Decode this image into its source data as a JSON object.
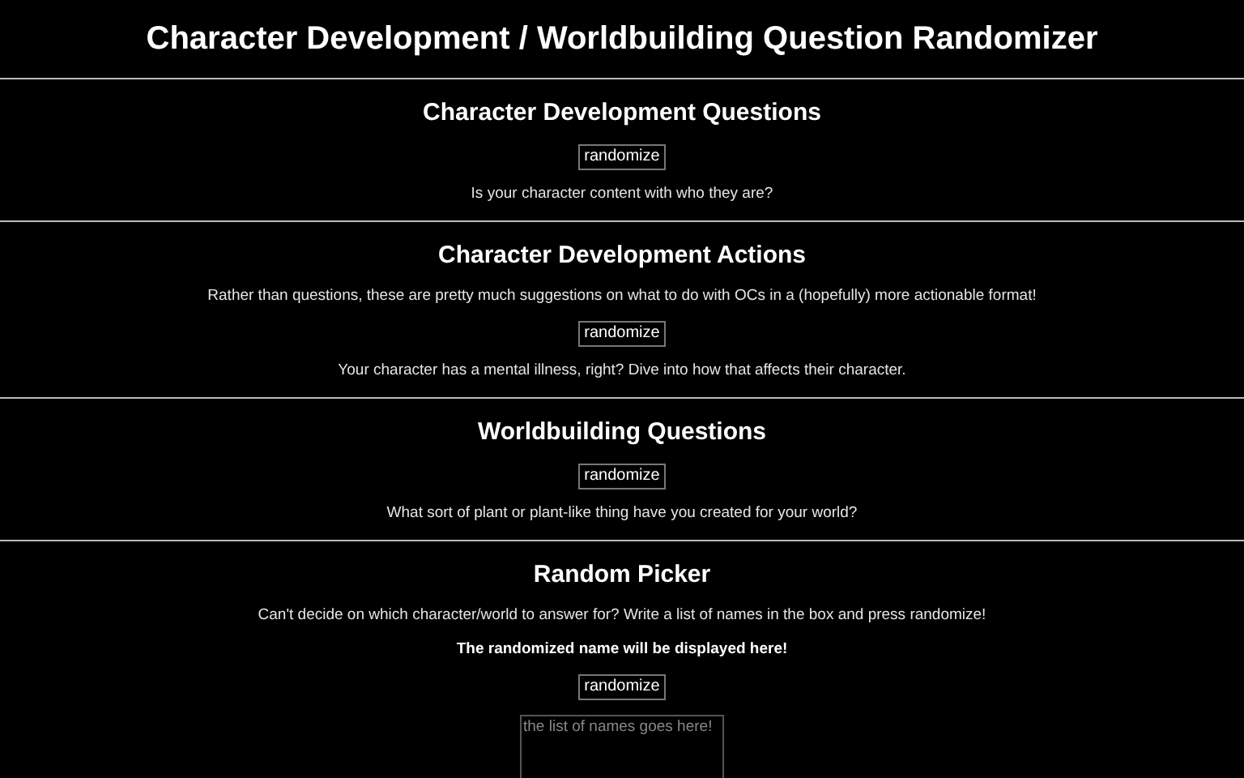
{
  "title": "Character Development / Worldbuilding Question Randomizer",
  "sections": [
    {
      "heading": "Character Development Questions",
      "items": [
        {
          "kind": "button",
          "label": "randomize"
        },
        {
          "kind": "output",
          "text": "Is your character content with who they are?"
        }
      ]
    },
    {
      "heading": "Character Development Actions",
      "items": [
        {
          "kind": "text",
          "text": "Rather than questions, these are pretty much suggestions on what to do with OCs in a (hopefully) more actionable format!"
        },
        {
          "kind": "button",
          "label": "randomize"
        },
        {
          "kind": "output",
          "text": "Your character has a mental illness, right? Dive into how that affects their character."
        }
      ]
    },
    {
      "heading": "Worldbuilding Questions",
      "items": [
        {
          "kind": "button",
          "label": "randomize"
        },
        {
          "kind": "output",
          "text": "What sort of plant or plant-like thing have you created for your world?"
        }
      ]
    },
    {
      "heading": "Random Picker",
      "items": [
        {
          "kind": "text",
          "text": "Can't decide on which character/world to answer for? Write a list of names in the box and press randomize!"
        },
        {
          "kind": "result",
          "text": "The randomized name will be displayed here!"
        },
        {
          "kind": "button",
          "label": "randomize"
        },
        {
          "kind": "textarea",
          "placeholder": "the list of names goes here!"
        }
      ]
    }
  ]
}
